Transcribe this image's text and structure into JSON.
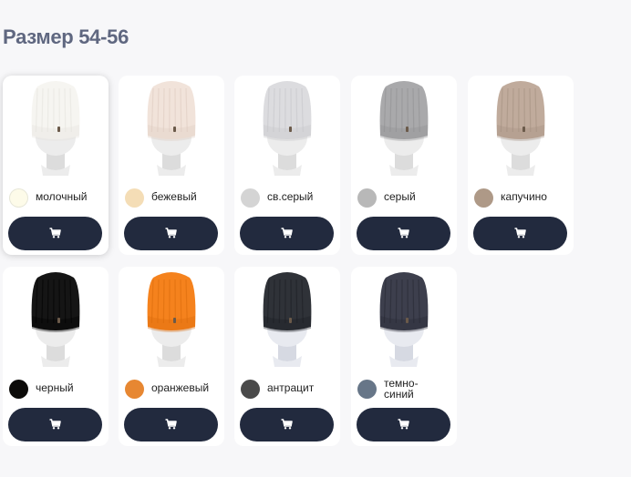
{
  "heading": "Размер 54-56",
  "products": [
    {
      "color_name": "молочный",
      "swatch": "#fdfbe9",
      "swatch_border": "#e6e6d8",
      "hat": "#f6f5f1",
      "hat_dark": "#e4e2dc",
      "mannequin": "light",
      "cart_icon": "cart-icon"
    },
    {
      "color_name": "бежевый",
      "swatch": "#f4ddb6",
      "hat": "#f1e3da",
      "hat_dark": "#dccac0",
      "mannequin": "light",
      "cart_icon": "cart-icon"
    },
    {
      "color_name": "св.серый",
      "swatch": "#d4d4d4",
      "hat": "#dcdcdf",
      "hat_dark": "#c5c5c9",
      "mannequin": "light",
      "cart_icon": "cart-icon"
    },
    {
      "color_name": "серый",
      "swatch": "#b8b8b8",
      "hat": "#a9a9ab",
      "hat_dark": "#8f8f92",
      "mannequin": "light",
      "cart_icon": "cart-icon"
    },
    {
      "color_name": "капучино",
      "swatch": "#ae9987",
      "hat": "#c0ab9c",
      "hat_dark": "#a38f80",
      "mannequin": "light",
      "cart_icon": "cart-icon"
    },
    {
      "color_name": "черный",
      "swatch": "#0c0b09",
      "hat": "#151515",
      "hat_dark": "#000000",
      "mannequin": "light",
      "cart_icon": "cart-icon"
    },
    {
      "color_name": "оранжевый",
      "swatch": "#e78732",
      "hat": "#f5821d",
      "hat_dark": "#d96b0b",
      "mannequin": "light",
      "cart_icon": "cart-icon"
    },
    {
      "color_name": "антрацит",
      "swatch": "#4a4a4a",
      "hat": "#2f3238",
      "hat_dark": "#1b1d22",
      "mannequin": "cool",
      "cart_icon": "cart-icon"
    },
    {
      "color_name": "темно-\nсиний",
      "swatch": "#677688",
      "hat": "#3d3f4d",
      "hat_dark": "#272833",
      "mannequin": "cool",
      "cart_icon": "cart-icon"
    }
  ]
}
